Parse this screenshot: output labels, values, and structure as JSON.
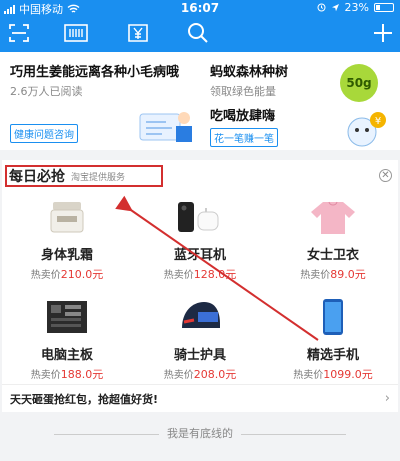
{
  "status_bar": {
    "carrier": "中国移动",
    "time": "16:07",
    "battery": "23%"
  },
  "toolbar": {
    "icons": [
      "scan-icon",
      "payment-code-icon",
      "coupon-icon",
      "search-icon",
      "add-icon"
    ]
  },
  "cards": [
    {
      "title": "巧用生姜能远离各种小毛病哦",
      "sub": "2.6万人已阅读",
      "chip": "健康问题咨询"
    },
    {
      "title": "蚂蚁森林种树",
      "sub": "领取绿色能量",
      "badge": "50g"
    },
    {
      "title": "吃喝放肆嗨",
      "chip": "花一笔赚一笔"
    }
  ],
  "deals": {
    "title": "每日必抢",
    "tag": "淘宝提供服务",
    "close": "✕",
    "products": [
      {
        "name": "身体乳霜",
        "price_label": "热卖价",
        "price": "210.0元"
      },
      {
        "name": "蓝牙耳机",
        "price_label": "热卖价",
        "price": "128.0元"
      },
      {
        "name": "女士卫衣",
        "price_label": "热卖价",
        "price": "89.0元"
      },
      {
        "name": "电脑主板",
        "price_label": "热卖价",
        "price": "188.0元"
      },
      {
        "name": "骑士护具",
        "price_label": "热卖价",
        "price": "208.0元"
      },
      {
        "name": "精选手机",
        "price_label": "热卖价",
        "price": "1099.0元"
      }
    ],
    "promo": "天天砸蛋抢红包，抢超值好货!",
    "promo_chevron": "›"
  },
  "footer": {
    "text": "我是有底线的"
  },
  "colors": {
    "brand_blue": "#1a8ff0",
    "price_red": "#e53935",
    "annotation_red": "#d32f2f"
  }
}
